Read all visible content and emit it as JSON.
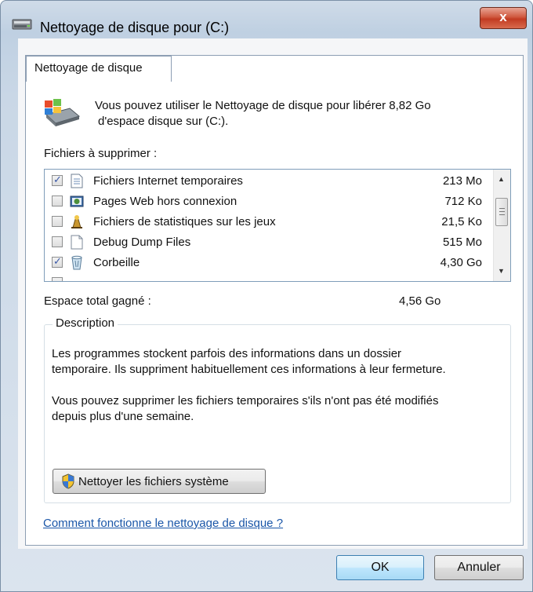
{
  "window": {
    "title": "Nettoyage de disque pour  (C:)",
    "close_label": "x"
  },
  "tab": {
    "label": "Nettoyage de disque"
  },
  "info": {
    "line1": "Vous pouvez utiliser le Nettoyage de disque pour libérer 8,82 Go",
    "line2": "d'espace disque sur  (C:)."
  },
  "files_label": "Fichiers à supprimer :",
  "files": [
    {
      "name": "Fichiers Internet temporaires",
      "size": "213 Mo",
      "checked": true,
      "icon": "text-document-icon"
    },
    {
      "name": "Pages Web hors connexion",
      "size": "712 Ko",
      "checked": false,
      "icon": "offline-web-icon"
    },
    {
      "name": "Fichiers de statistiques sur les jeux",
      "size": "21,5 Ko",
      "checked": false,
      "icon": "game-stats-icon"
    },
    {
      "name": "Debug Dump Files",
      "size": "515 Mo",
      "checked": false,
      "icon": "blank-file-icon"
    },
    {
      "name": "Corbeille",
      "size": "4,30 Go",
      "checked": true,
      "icon": "recycle-bin-icon"
    }
  ],
  "total": {
    "label": "Espace total gagné :",
    "value": "4,56 Go"
  },
  "description": {
    "legend": "Description",
    "p1_line1": "Les programmes stockent parfois des informations dans un dossier",
    "p1_line2": "temporaire. Ils suppriment habituellement ces informations à leur fermeture.",
    "p2_line1": "Vous pouvez supprimer les fichiers temporaires s'ils n'ont pas été modifiés",
    "p2_line2": "depuis plus d'une semaine."
  },
  "system_button": {
    "label": "Nettoyer les fichiers système"
  },
  "help_link": {
    "label": "Comment fonctionne le nettoyage de disque ?"
  },
  "buttons": {
    "ok": "OK",
    "cancel": "Annuler"
  },
  "colors": {
    "link": "#1a56a8",
    "close": "#c23b22",
    "accent_border": "#3c7fb1"
  }
}
